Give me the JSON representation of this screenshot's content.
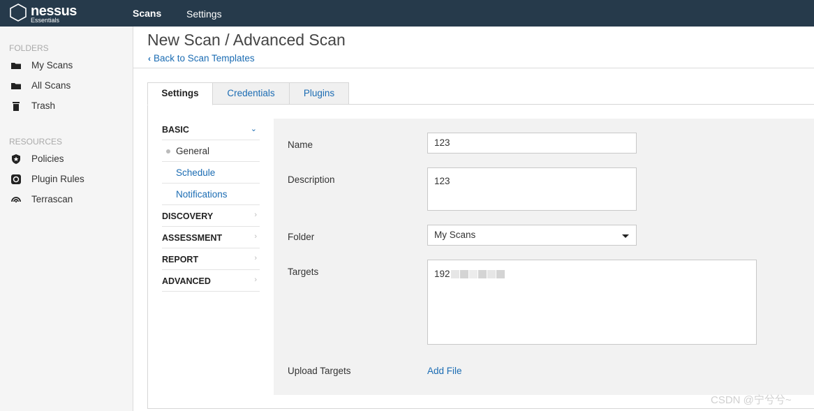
{
  "app": {
    "logo_name": "nessus",
    "logo_sub": "Essentials",
    "nav": {
      "scans": "Scans",
      "settings": "Settings"
    }
  },
  "sidebar": {
    "folders_heading": "FOLDERS",
    "folders": [
      {
        "label": "My Scans",
        "icon": "folder-icon"
      },
      {
        "label": "All Scans",
        "icon": "folder-icon"
      },
      {
        "label": "Trash",
        "icon": "trash-icon"
      }
    ],
    "resources_heading": "RESOURCES",
    "resources": [
      {
        "label": "Policies",
        "icon": "shield-icon"
      },
      {
        "label": "Plugin Rules",
        "icon": "plugin-rules-icon"
      },
      {
        "label": "Terrascan",
        "icon": "terrascan-icon"
      }
    ]
  },
  "header": {
    "title": "New Scan / Advanced Scan",
    "back_link": "Back to Scan Templates"
  },
  "tabs": [
    {
      "label": "Settings",
      "active": true
    },
    {
      "label": "Credentials",
      "active": false
    },
    {
      "label": "Plugins",
      "active": false
    }
  ],
  "settings_nav": {
    "basic": "BASIC",
    "basic_items": [
      "General",
      "Schedule",
      "Notifications"
    ],
    "discovery": "DISCOVERY",
    "assessment": "ASSESSMENT",
    "report": "REPORT",
    "advanced": "ADVANCED"
  },
  "form": {
    "name_label": "Name",
    "name_value": "123",
    "description_label": "Description",
    "description_value": "123",
    "folder_label": "Folder",
    "folder_value": "My Scans",
    "targets_label": "Targets",
    "targets_value": "192",
    "upload_label": "Upload Targets",
    "add_file": "Add File"
  },
  "watermark": "CSDN @宁兮兮~",
  "colors": {
    "topbar": "#263a4b",
    "link": "#1b6cb3",
    "panel": "#f2f2f2"
  }
}
